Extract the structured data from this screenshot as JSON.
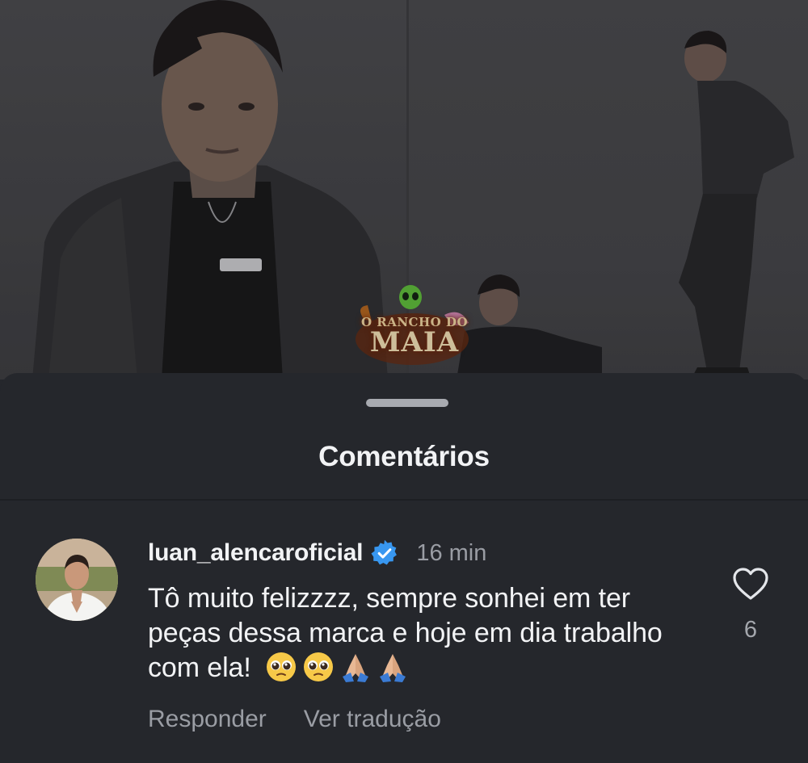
{
  "watermark": {
    "line1": "O RANCHO DO",
    "line2": "MAIA"
  },
  "sheet": {
    "title": "Comentários"
  },
  "comment": {
    "username": "luan_alencaroficial",
    "verified": true,
    "timestamp": "16 min",
    "text": "Tô muito felizzzz, sempre sonhei em ter peças dessa marca e hoje em dia trabalho com ela!",
    "emojis": [
      "pleading-face",
      "pleading-face",
      "folded-hands",
      "folded-hands"
    ],
    "reply_label": "Responder",
    "translate_label": "Ver tradução",
    "like_count": "6"
  },
  "icons": {
    "verified": "verified-badge-icon",
    "like": "heart-outline-icon"
  },
  "colors": {
    "sheet_bg": "#25272c",
    "primary_text": "#f2f3f5",
    "secondary_text": "#9a9da4",
    "verified_blue": "#3897f0"
  }
}
